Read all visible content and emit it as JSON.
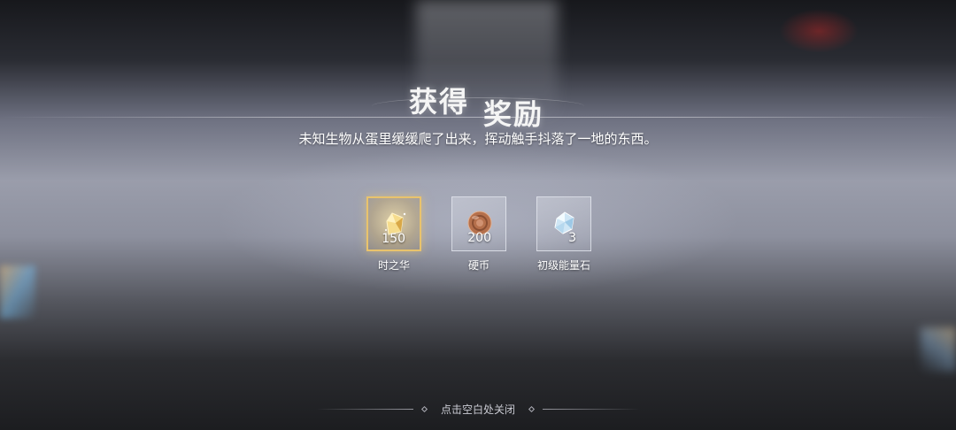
{
  "title": {
    "part1": "获得",
    "part2": "奖励"
  },
  "subtitle": "未知生物从蛋里缓缓爬了出来，挥动触手抖落了一地的东西。",
  "rewards": [
    {
      "name": "时之华",
      "count": "150",
      "icon": "gold-crystal-icon",
      "highlighted": true,
      "color": "#e9c36c"
    },
    {
      "name": "硬币",
      "count": "200",
      "icon": "copper-coin-icon",
      "highlighted": false,
      "color": "#b5704c"
    },
    {
      "name": "初级能量石",
      "count": "3",
      "icon": "blue-energy-stone-icon",
      "highlighted": false,
      "color": "#cfe6f5"
    }
  ],
  "close_hint": "点击空白处关闭"
}
